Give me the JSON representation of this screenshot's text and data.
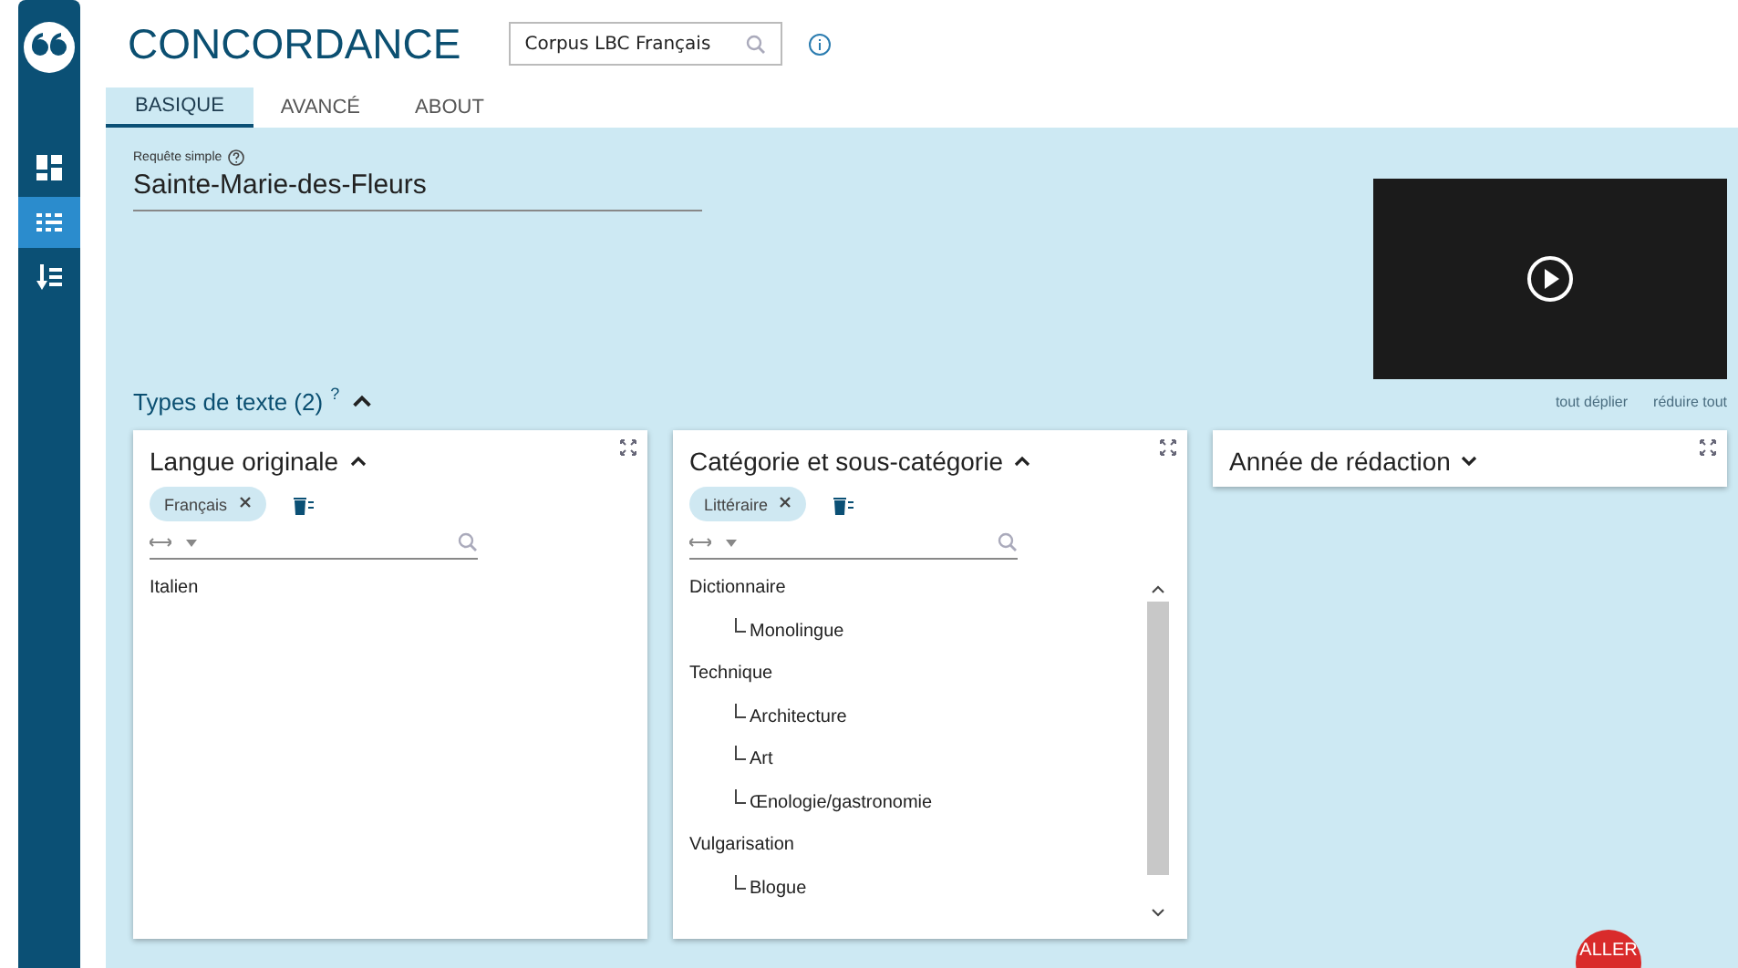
{
  "app": {
    "title": "CONCORDANCE",
    "corpus_field": {
      "value": "Corpus LBC Français"
    }
  },
  "sidebar": {
    "items": [
      {
        "kind": "grid",
        "selected": false
      },
      {
        "kind": "list",
        "selected": true
      },
      {
        "kind": "sort",
        "selected": false
      }
    ]
  },
  "tabs": [
    {
      "label": "BASIQUE",
      "selected": true
    },
    {
      "label": "AVANCÉ",
      "selected": false
    },
    {
      "label": "ABOUT",
      "selected": false
    }
  ],
  "query": {
    "label": "Requête simple",
    "value": "Sainte-Marie-des-Fleurs"
  },
  "text_types": {
    "title": "Types de texte (2)",
    "help": "?",
    "expanded": true,
    "expand_all": "tout déplier",
    "collapse_all": "réduire tout",
    "panels": [
      {
        "title": "Langue originale",
        "expanded": true,
        "chips": [
          "Français"
        ],
        "items": [
          {
            "label": "Italien"
          }
        ]
      },
      {
        "title": "Catégorie et sous-catégorie",
        "expanded": true,
        "chips": [
          "Littéraire"
        ],
        "items": [
          {
            "label": "Dictionnaire",
            "children": [
              {
                "label": "Monolingue"
              }
            ]
          },
          {
            "label": "Technique",
            "children": [
              {
                "label": "Architecture"
              },
              {
                "label": "Art"
              },
              {
                "label": "Œnologie/gastronomie"
              }
            ]
          },
          {
            "label": "Vulgarisation",
            "children": [
              {
                "label": "Blogue"
              }
            ]
          }
        ]
      },
      {
        "title": "Année de rédaction",
        "expanded": false
      }
    ]
  },
  "go_button": {
    "label": "ALLER"
  }
}
